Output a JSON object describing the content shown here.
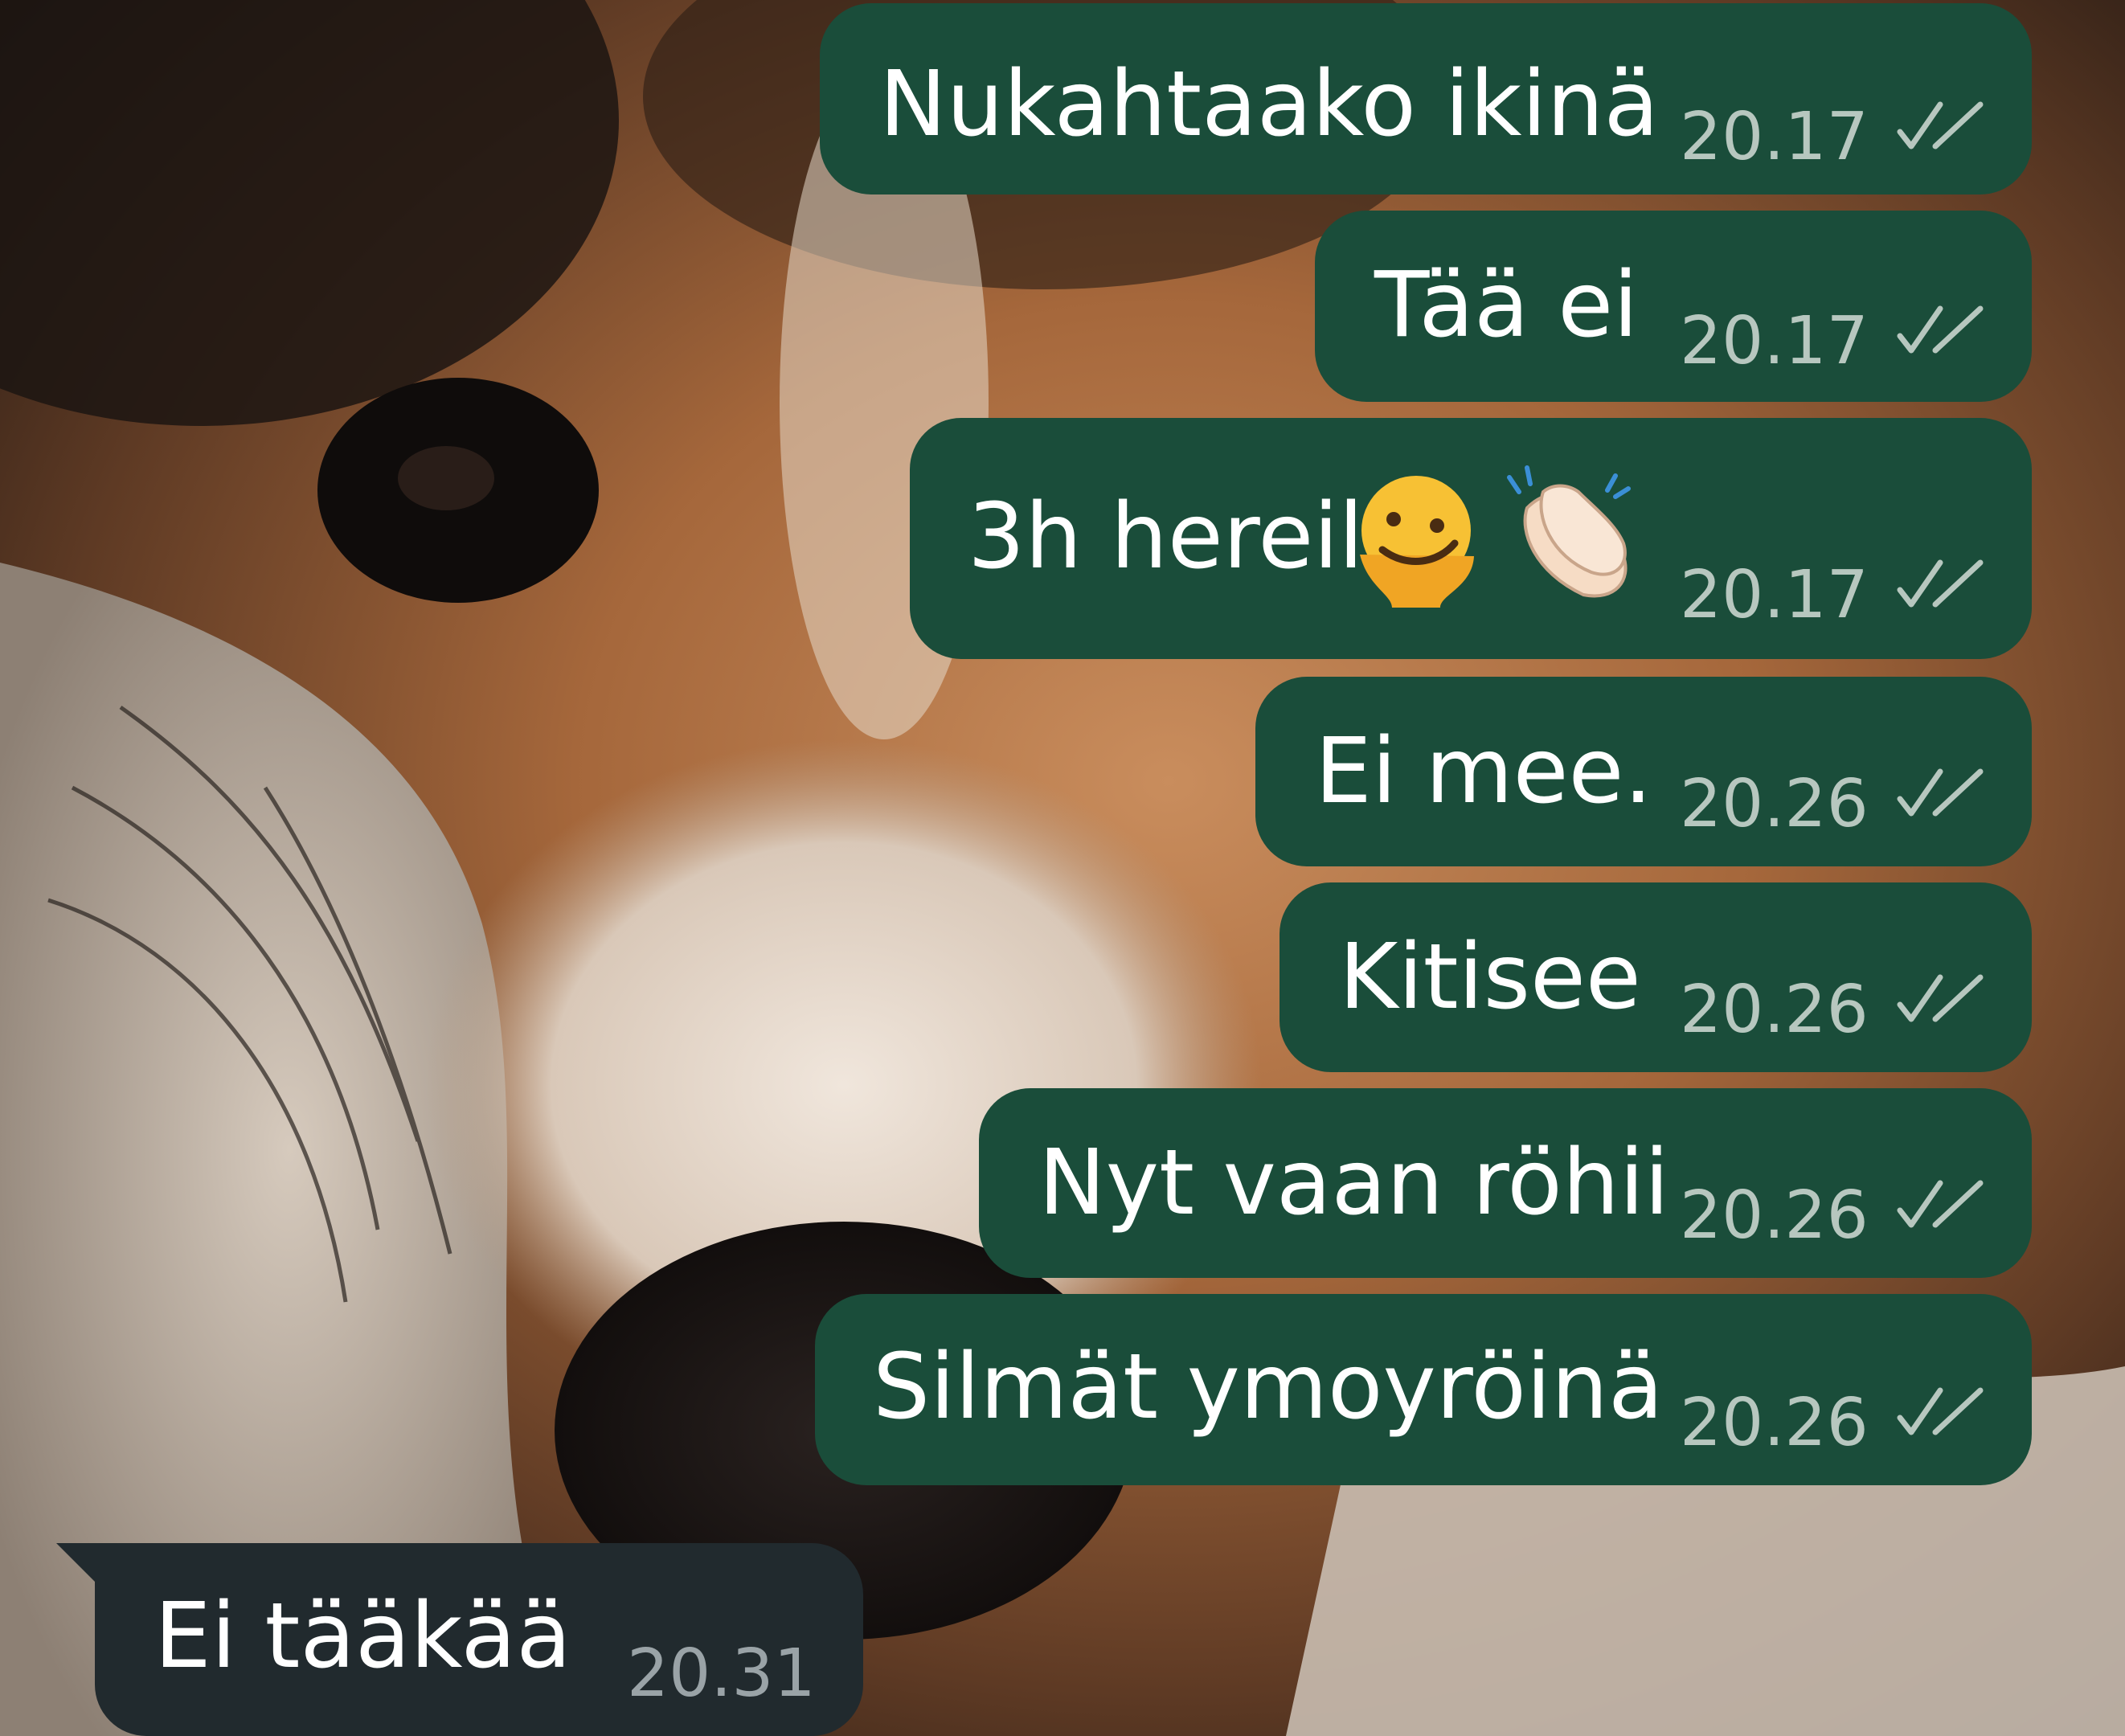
{
  "messages": [
    {
      "direction": "outgoing",
      "text": "Nukahtaako ikinä",
      "time": "20.17",
      "status": "read-double-check-icon"
    },
    {
      "direction": "outgoing",
      "text": "Tää ei",
      "time": "20.17",
      "status": "read-double-check-icon"
    },
    {
      "direction": "outgoing",
      "text": "3h hereil",
      "emojis": [
        "melting-face-emoji",
        "clapping-hands-emoji"
      ],
      "time": "20.17",
      "status": "read-double-check-icon"
    },
    {
      "direction": "outgoing",
      "text": "Ei mee.",
      "time": "20.26",
      "status": "read-double-check-icon"
    },
    {
      "direction": "outgoing",
      "text": "Kitisee",
      "time": "20.26",
      "status": "read-double-check-icon"
    },
    {
      "direction": "outgoing",
      "text": "Nyt vaan röhii",
      "time": "20.26",
      "status": "read-double-check-icon"
    },
    {
      "direction": "outgoing",
      "text": "Silmät ymoyröinä",
      "time": "20.26",
      "status": "read-double-check-icon"
    },
    {
      "direction": "incoming",
      "text": "Ei tääkää",
      "time": "20.31"
    }
  ],
  "colors": {
    "outgoing_bubble": "#1a4d3a",
    "incoming_bubble": "#212a2e",
    "timestamp": "#b7c7bf",
    "message_text": "#ffffff"
  }
}
